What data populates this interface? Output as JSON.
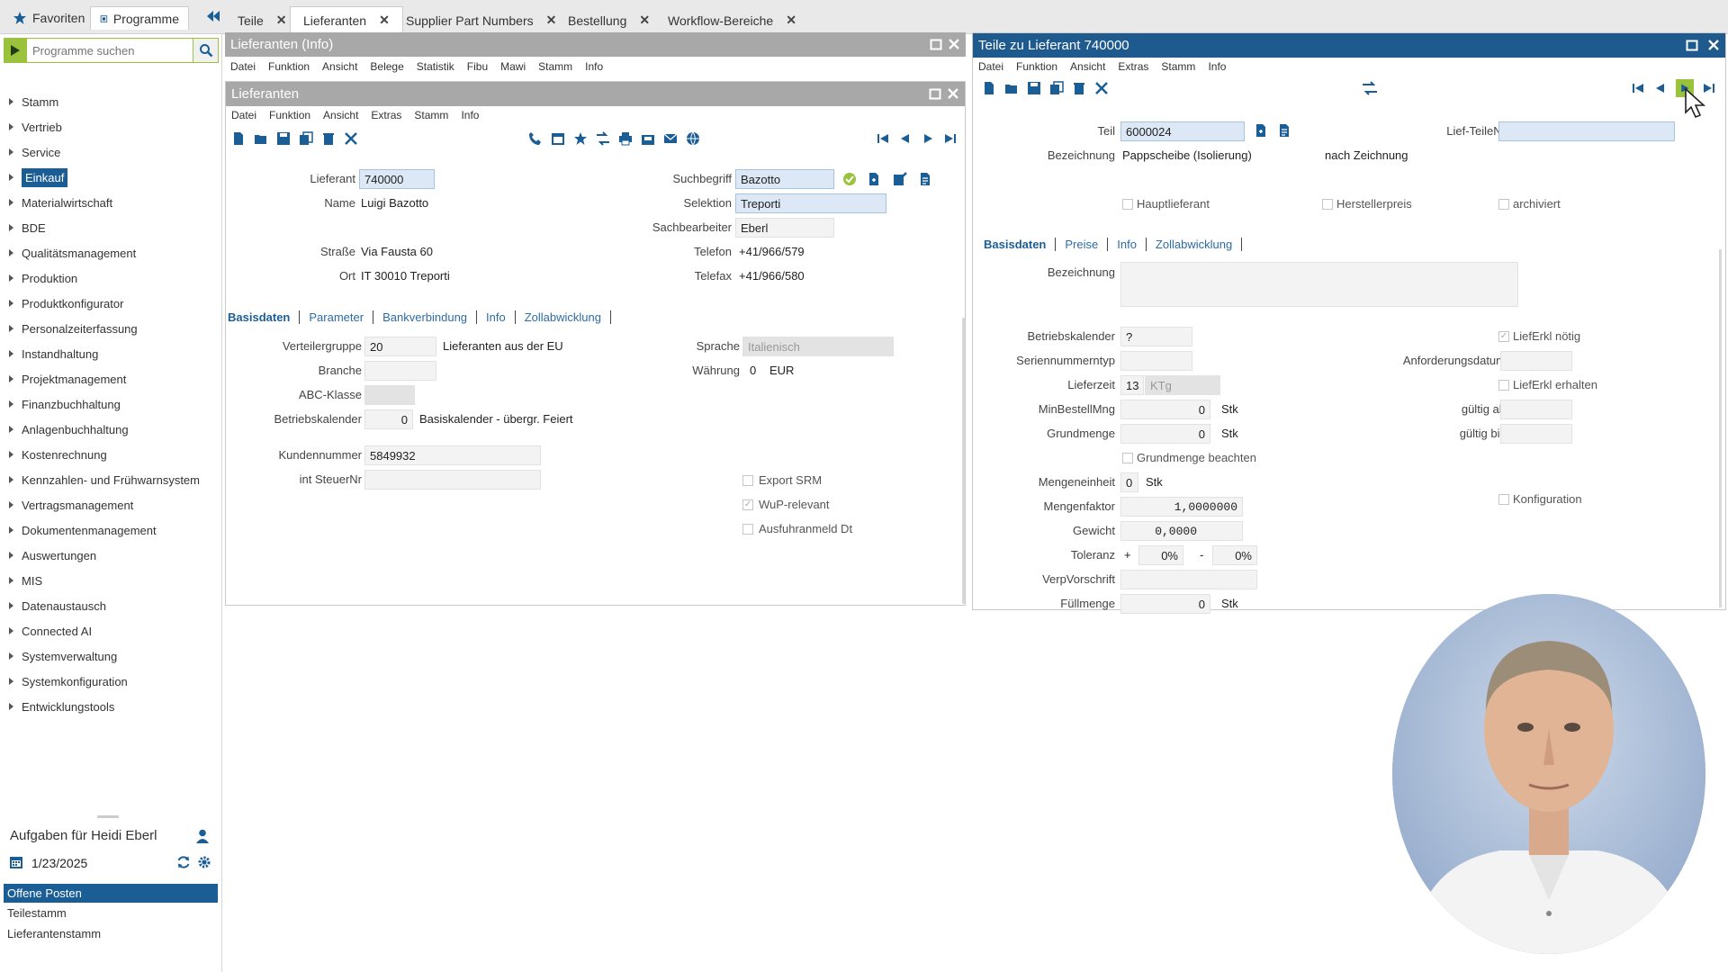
{
  "topnav": {
    "favorites": "Favoriten",
    "programs": "Programme",
    "tabs": [
      {
        "label": "Teile"
      },
      {
        "label": "Lieferanten"
      },
      {
        "label": "Supplier Part Numbers"
      },
      {
        "label": "Bestellung"
      },
      {
        "label": "Workflow-Bereiche"
      }
    ]
  },
  "sidebar": {
    "search_placeholder": "Programme suchen",
    "items": [
      {
        "label": "Stamm"
      },
      {
        "label": "Vertrieb"
      },
      {
        "label": "Service"
      },
      {
        "label": "Einkauf"
      },
      {
        "label": "Materialwirtschaft"
      },
      {
        "label": "BDE"
      },
      {
        "label": "Qualitätsmanagement"
      },
      {
        "label": "Produktion"
      },
      {
        "label": "Produktkonfigurator"
      },
      {
        "label": "Personalzeiterfassung"
      },
      {
        "label": "Instandhaltung"
      },
      {
        "label": "Projektmanagement"
      },
      {
        "label": "Finanzbuchhaltung"
      },
      {
        "label": "Anlagenbuchhaltung"
      },
      {
        "label": "Kostenrechnung"
      },
      {
        "label": "Kennzahlen- und Frühwarnsystem"
      },
      {
        "label": "Vertragsmanagement"
      },
      {
        "label": "Dokumentenmanagement"
      },
      {
        "label": "Auswertungen"
      },
      {
        "label": "MIS"
      },
      {
        "label": "Datenaustausch"
      },
      {
        "label": "Connected AI"
      },
      {
        "label": "Systemverwaltung"
      },
      {
        "label": "Systemkonfiguration"
      },
      {
        "label": "Entwicklungstools"
      }
    ]
  },
  "tasks": {
    "title": "Aufgaben für Heidi Eberl",
    "date": "1/23/2025",
    "items": [
      {
        "label": "Offene Posten"
      },
      {
        "label": "Teilestamm"
      },
      {
        "label": "Lieferantenstamm"
      }
    ]
  },
  "panel_info": {
    "title": "Lieferanten (Info)",
    "menu": [
      "Datei",
      "Funktion",
      "Ansicht",
      "Belege",
      "Statistik",
      "Fibu",
      "Mawi",
      "Stamm",
      "Info"
    ]
  },
  "panel_supplier": {
    "title": "Lieferanten",
    "menu": [
      "Datei",
      "Funktion",
      "Ansicht",
      "Extras",
      "Stamm",
      "Info"
    ],
    "labels": {
      "lieferant": "Lieferant",
      "name": "Name",
      "strasse": "Straße",
      "ort": "Ort",
      "suchbegriff": "Suchbegriff",
      "selektion": "Selektion",
      "sachbearbeiter": "Sachbearbeiter",
      "telefon": "Telefon",
      "telefax": "Telefax",
      "verteilergruppe": "Verteilergruppe",
      "branche": "Branche",
      "abc": "ABC-Klasse",
      "betriebskalender": "Betriebskalender",
      "kundennummer": "Kundennummer",
      "steuernr": "int SteuerNr",
      "sprache": "Sprache",
      "waehrung": "Währung"
    },
    "values": {
      "lieferant": "740000",
      "name": "Luigi Bazotto",
      "strasse": "Via Fausta 60",
      "ort": "IT 30010 Treporti",
      "suchbegriff": "Bazotto",
      "selektion": "Treporti",
      "sachbearbeiter": "Eberl",
      "telefon": "+41/966/579",
      "telefax": "+41/966/580",
      "verteilergruppe": "20",
      "verteilergruppe_text": "Lieferanten aus der EU",
      "betriebskalender": "0",
      "betriebskalender_text": "Basiskalender - übergr. Feiert",
      "kundennummer": "5849932",
      "sprache": "Italienisch",
      "waehrung_code": "0",
      "waehrung": "EUR"
    },
    "tabs": [
      "Basisdaten",
      "Parameter",
      "Bankverbindung",
      "Info",
      "Zollabwicklung"
    ],
    "checkboxes": [
      {
        "label": "Export SRM",
        "checked": false
      },
      {
        "label": "WuP-relevant",
        "checked": true
      },
      {
        "label": "Ausfuhranmeld Dt",
        "checked": false
      }
    ]
  },
  "panel_parts": {
    "title": "Teile zu Lieferant 740000",
    "menu": [
      "Datei",
      "Funktion",
      "Ansicht",
      "Extras",
      "Stamm",
      "Info"
    ],
    "labels": {
      "teil": "Teil",
      "lief_teilenr": "Lief-TeileNr",
      "bezeichnung": "Bezeichnung",
      "bezeichnung2": "Bezeichnung",
      "betriebskalender": "Betriebskalender",
      "seriennummerntyp": "Seriennummerntyp",
      "lieferzeit": "Lieferzeit",
      "minbestellmng": "MinBestellMng",
      "grundmenge": "Grundmenge",
      "mengeneinheit": "Mengeneinheit",
      "mengenfaktor": "Mengenfaktor",
      "gewicht": "Gewicht",
      "toleranz": "Toleranz",
      "verpvorschrift": "VerpVorschrift",
      "fuellmenge": "Füllmenge",
      "anforderungsdatum": "Anforderungsdatum",
      "gueltig_ab": "gültig ab",
      "gueltig_bis": "gültig bis"
    },
    "values": {
      "teil": "6000024",
      "bezeichnung": "Pappscheibe (Isolierung)",
      "nach_zeichnung": "nach Zeichnung",
      "betriebskalender": "?",
      "lieferzeit": "13",
      "lieferzeit_unit": "KTg",
      "minbestellmng": "0",
      "minbestellmng_unit": "Stk",
      "grundmenge": "0",
      "grundmenge_unit": "Stk",
      "mengeneinheit": "0",
      "mengeneinheit_unit": "Stk",
      "mengenfaktor": "1,0000000",
      "gewicht": "0,0000",
      "toleranz_plus": "+",
      "toleranz_plus_val": "0%",
      "toleranz_minus": "-",
      "toleranz_minus_val": "0%",
      "fuellmenge": "0",
      "fuellmenge_unit": "Stk"
    },
    "checkboxes_top": [
      {
        "label": "Hauptlieferant",
        "checked": false
      },
      {
        "label": "Herstellerpreis",
        "checked": false
      },
      {
        "label": "archiviert",
        "checked": false
      }
    ],
    "tabs": [
      "Basisdaten",
      "Preise",
      "Info",
      "Zollabwicklung"
    ],
    "checkboxes": {
      "grundmenge_beachten": "Grundmenge beachten",
      "lieferkl_noetig": "LiefErkl nötig",
      "lieferkl_erhalten": "LiefErkl erhalten",
      "konfiguration": "Konfiguration"
    }
  },
  "colors": {
    "accent": "#1e5a8e",
    "green": "#9bc23c",
    "panel_grey": "#a8a8a8"
  }
}
